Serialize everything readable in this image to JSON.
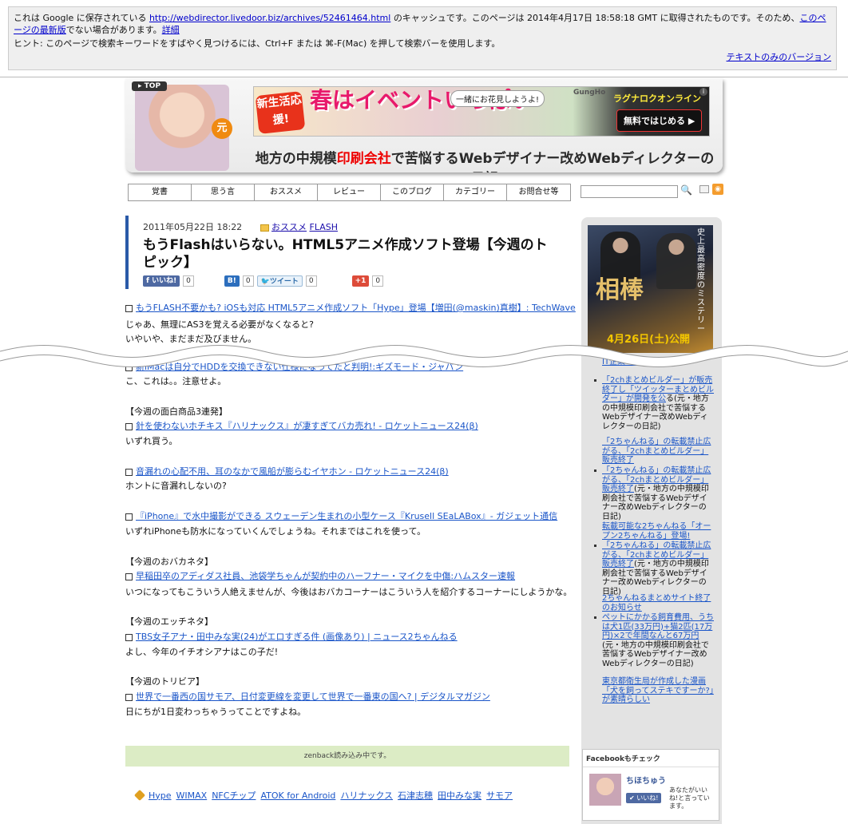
{
  "cache": {
    "line1_pre": "これは Google に保存されている",
    "url": "http://webdirector.livedoor.biz/archives/52461464.html",
    "line1_mid": "のキャッシュです。このページは 2014年4月17日 18:58:18 GMT に取得されたものです。そのため、",
    "latest_link": "このページの最新版",
    "line1_post": "でない場合があります。",
    "detail_link": "詳細",
    "hint": "ヒント: このページで検索キーワードをすばやく見つけるには、Ctrl+F または ⌘-F(Mac) を押して検索バーを使用します。",
    "text_only": "テキストのみのバージョン"
  },
  "banner": {
    "top_tag": "TOP",
    "badge": "元",
    "ad_c1": "新生活応援!",
    "ad_c2": "春はイベントいっぱい",
    "ad_c3": "一緒にお花見しようよ!",
    "ad_brand": "GungHo",
    "ad_game": "ラグナロクオンライン",
    "ad_cta": "無料ではじめる",
    "site_title_pre": "地方の中規模",
    "site_title_red": "印刷会社",
    "site_title_post": "で苦悩するWebデザイナー改めWebディレクターの日記"
  },
  "nav": [
    "覚書",
    "思う言",
    "おススメ",
    "レビュー",
    "このブログ",
    "カテゴリー",
    "お問合せ等"
  ],
  "post": {
    "date": "2011年05月22日 18:22",
    "cat1": "おススメ",
    "cat2": "FLASH",
    "title": "もうFlashはいらない。HTML5アニメ作成ソフト登場【今週のトピック】",
    "like_label": "いいね!",
    "like_count": "0",
    "hatena_label": "B!",
    "hatena_count": "0",
    "tweet_label": "ツイート",
    "tweet_count": "0",
    "gplus_label": "+1",
    "gplus_count": "0"
  },
  "body": {
    "l1_link": "もうFLASH不要かも? iOSも対応 HTML5アニメ作成ソフト「Hype」登場【増田(@maskin)真樹】: TechWave",
    "l2": "じゃあ、無理にAS3を覚える必要がなくなると?",
    "l3": "いやいや、まだまだ及びません。",
    "l4_link": "新iMacは自分でHDDを交換できない仕様になってたと判明!:ギズモード・ジャパン",
    "l5": "こ、これは。。注意せよ。",
    "h1": "【今週の面白商品3連発】",
    "l6_link": "針を使わないホチキス『ハリナックス』が凄すぎてバカ売れ! - ロケットニュース24(β)",
    "l7": "いずれ買う。",
    "l8_link": "音漏れの心配不用、耳のなかで風船が膨らむイヤホン - ロケットニュース24(β)",
    "l9": "ホントに音漏れしないの?",
    "l10_link": "『iPhone』で水中撮影ができる スウェーデン生まれの小型ケース『Krusell SEaLABox』- ガジェット通信",
    "l11": "いずれiPhoneも防水になっていくんでしょうね。それまではこれを使って。",
    "h2": "【今週のおバカネタ】",
    "l12_link": "早稲田卒のアディダス社員、池袋学ちゃんが契約中のハーフナー・マイクを中傷:ハムスター速報",
    "l13": "いつになってもこういう人絶えませんが、今後はおバカコーナーはこういう人を紹介するコーナーにしようかな。",
    "h3": "【今週のエッチネタ】",
    "l14_link": "TBS女子アナ・田中みな実(24)がエロすぎる件 (画像あり) | ニュース2ちゃんねる",
    "l15": "よし、今年のイチオシアナはこの子だ!",
    "h4": "【今週のトリビア】",
    "l16_link": "世界で一番西の国サモア、日付変更線を変更して世界で一番東の国へ? | デジタルマガジン",
    "l17": "日にちが1日変わっちゃうってことですよね。"
  },
  "zenback": "zenback読み込み中です。",
  "tags": [
    "Hype",
    "WIMAX",
    "NFCチップ",
    "ATOK for Android",
    "ハリナックス",
    "石津志穂",
    "田中みな実",
    "サモア"
  ],
  "sidebar": {
    "movie_title": "相棒",
    "movie_vert": "史上最高密度のミステリー",
    "movie_date": "4月26日(土)公開",
    "items": [
      {
        "link": "IT企業「こうかいい",
        "text": ""
      },
      {
        "link": "「2chまとめビルダー」が販売終了し「ツイッターまとめビルダー」が開発を公",
        "text": "る(元・地方の中規模印刷会社で苦悩するWebデザイナー改めWebディレクターの日記)"
      },
      {
        "link": "「2ちゃんねる」の転載禁止広がる、「2chまとめビルダー」販売終了",
        "text": ""
      },
      {
        "link": "「2ちゃんねる」の転載禁止広がる、「2chまとめビルダー」販売終了",
        "text": "(元・地方の中規模印刷会社で苦悩するWebデザイナー改めWebディレクターの日記)"
      },
      {
        "link": "転載可能な2ちゃんねる「オープン2ちゃんねる」登場!",
        "text": ""
      },
      {
        "link": "「2ちゃんねる」の転載禁止広がる、「2chまとめビルダー」販売終了",
        "text": "(元・地方の中規模印刷会社で苦悩するWebデザイナー改めWebディレクターの日記)"
      },
      {
        "link": "2ちゃんねるまとめサイト終了のお知らせ",
        "text": ""
      },
      {
        "link": "ペットにかかる飼育費用、うちは犬1匹(33万円)+猫2匹(17万円)×2で年間なんと67万円",
        "text": "(元・地方の中規模印刷会社で苦悩するWebデザイナー改めWebディレクターの日記)"
      },
      {
        "link": "東京都衛生局が作成した漫画「犬を飼ってステキですーか?」が素晴らしい",
        "text": ""
      }
    ],
    "fb_header": "Facebookもチェック",
    "fb_name": "ちほちゅう",
    "fb_like": "いいね!",
    "fb_desc": "あなたがいいね!と言っています。"
  }
}
